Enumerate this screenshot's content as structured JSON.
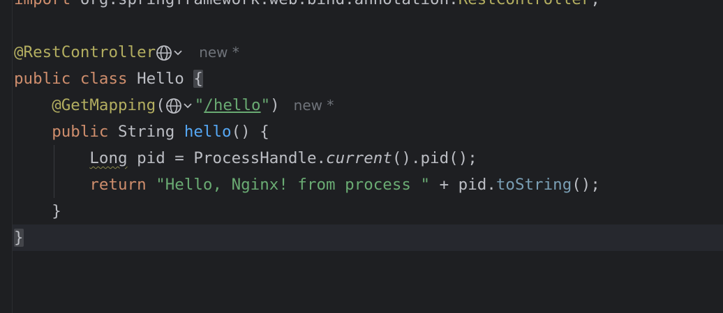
{
  "editor": {
    "line_import": "import org.springframework.web.bind.annotation.RestController;",
    "import_kw": "import",
    "import_pkg": " org.springframework.web.bind.annotation.",
    "import_cls": "RestController",
    "import_semi": ";",
    "annotation_rest": "@RestController",
    "hint_new_1": "new *",
    "class_public": "public",
    "class_kw": "class",
    "class_name": "Hello",
    "open_brace": "{",
    "annotation_get": "@GetMapping",
    "paren_open": "(",
    "mapping_path": "/hello",
    "quote": "\"",
    "paren_close": ")",
    "hint_new_2": "new *",
    "method_public": "public",
    "method_type": "String",
    "method_name": "hello",
    "method_sig_rest": "() {",
    "type_long": "Long",
    "var_decl_rest": " pid = ProcessHandle.",
    "current_call": "current",
    "pid_call": "().pid();",
    "return_kw": "return",
    "return_str": "\"Hello, Nginx! from process \"",
    "plus_pid": " + pid.",
    "to_string": "toString",
    "end_call": "();",
    "method_close": "}",
    "class_close": "}"
  },
  "colors": {
    "background": "#1e1f22",
    "keyword": "#cf8e6d",
    "annotation": "#b3ae60",
    "string": "#6aab73",
    "function": "#56a8f5",
    "text": "#bcbec4"
  },
  "icons": [
    "globe-icon",
    "chevron-down-icon"
  ]
}
